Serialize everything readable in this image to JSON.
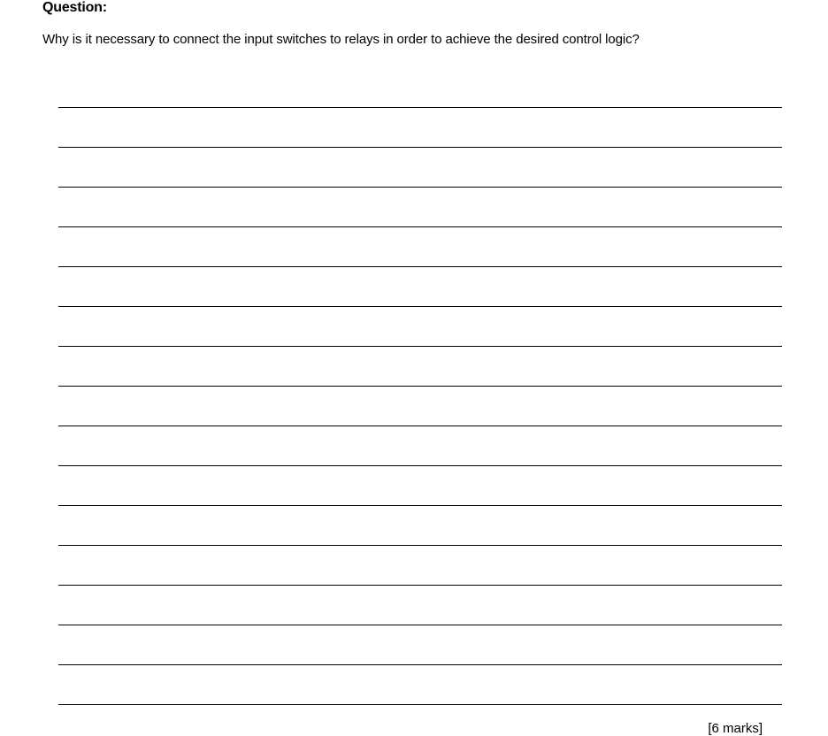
{
  "question": {
    "heading": "Question:",
    "text": "Why is it necessary to connect the input switches to relays in order to achieve the desired control logic?",
    "marks": "[6 marks]",
    "blank_lines_count": 16
  }
}
